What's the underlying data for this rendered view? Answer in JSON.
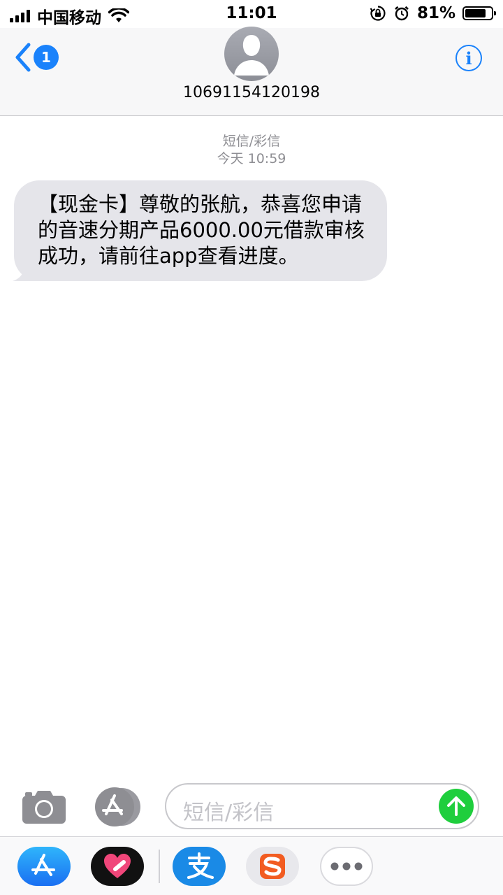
{
  "status_bar": {
    "carrier": "中国移动",
    "time": "11:01",
    "battery": "81%",
    "battery_level": 0.81
  },
  "header": {
    "back_badge": "1",
    "contact_name": "10691154120198"
  },
  "conversation": {
    "service_label": "短信/彩信",
    "timestamp": "今天 10:59",
    "messages": [
      {
        "direction": "incoming",
        "text": "【现金卡】尊敬的张航，恭喜您申请的音速分期产品6000.00元借款审核成功，请前往app查看进度。"
      }
    ]
  },
  "compose": {
    "placeholder": "短信/彩信"
  },
  "colors": {
    "accent": "#1a82fb",
    "send": "#1fce3d",
    "incoming_bubble": "#e5e5ea"
  },
  "icons": {
    "back": "chevron-left-icon",
    "info": "info-icon",
    "camera": "camera-icon",
    "apps": "app-store-icon",
    "send": "arrow-up-icon",
    "tray": [
      "app-store-icon",
      "heart-icon",
      "alipay-icon",
      "sogou-icon",
      "more-icon"
    ]
  }
}
